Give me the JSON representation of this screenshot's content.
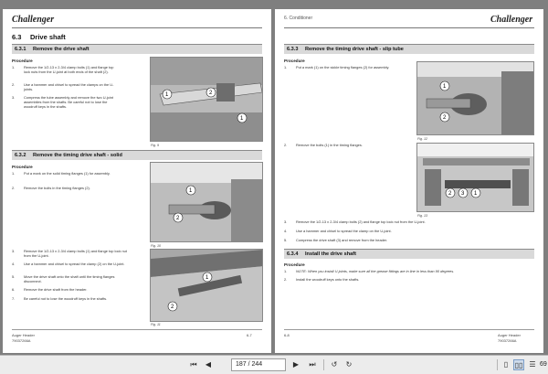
{
  "left_page": {
    "brand": "Challenger",
    "section_title": "6.3",
    "section_name": "Drive shaft",
    "sub1": {
      "number": "6.3.1",
      "title": "Remove the drive shaft"
    },
    "proc1": "Procedure",
    "steps1": [
      {
        "n": "1.",
        "text": "Remove the 1/2-13 x 2-3/4 clamp bolts (1) and flange top lock nuts from the U-joint at both ends of the shaft (2)."
      },
      {
        "n": "2.",
        "text": "Use a hammer and chisel to spread the clamps on the U-joints."
      },
      {
        "n": "3.",
        "text": "Compress the tube assembly and remove the two U-joint assemblies from the shafts. Be careful not to lose the woodruff keys in the shafts."
      }
    ],
    "fig9": "Fig. 9",
    "sub2": {
      "number": "6.3.2",
      "title": "Remove the timing drive shaft - solid"
    },
    "proc2": "Procedure",
    "steps2a": [
      {
        "n": "1.",
        "text": "Put a mark on the solid timing flanges (1) for assembly."
      },
      {
        "n": "2.",
        "text": "Remove the bolts in the timing flanges (2)."
      }
    ],
    "fig10": "Fig. 10",
    "steps2b": [
      {
        "n": "3.",
        "text": "Remove the 1/2-13 x 2-3/4 clamp bolts (1) and flange top lock nut from the U-joint."
      },
      {
        "n": "4.",
        "text": "Use a hammer and chisel to spread the clamp (2) on the U-joint."
      },
      {
        "n": "5.",
        "text": "Move the drive shaft onto the shaft until the timing flanges disconnect."
      },
      {
        "n": "6.",
        "text": "Remove the drive shaft from the header."
      },
      {
        "n": "7.",
        "text": "Be careful not to lose the woodruff keys in the shafts."
      }
    ],
    "fig11": "Fig. 11",
    "footer_left_1": "Auger Header",
    "footer_left_2": "79037266A",
    "footer_right": "6-7"
  },
  "right_page": {
    "brand": "Challenger",
    "section_header": "6. Conditioner",
    "sub3": {
      "number": "6.3.3",
      "title": "Remove the timing drive shaft - slip tube"
    },
    "proc3": "Procedure",
    "steps3a": [
      {
        "n": "1.",
        "text": "Put a mark (1) on the sickle timing flanges (2) for assembly."
      }
    ],
    "fig12": "Fig. 12",
    "steps3b": [
      {
        "n": "2.",
        "text": "Remove the bolts (1) in the timing flanges."
      }
    ],
    "fig13": "Fig. 13",
    "steps3c": [
      {
        "n": "3.",
        "text": "Remove the 1/2-13 x 2-3/4 clamp bolts (2) and flange top lock nut from the U-joint."
      },
      {
        "n": "4.",
        "text": "Use a hammer and chisel to spread the clamp on the U-joint."
      },
      {
        "n": "5.",
        "text": "Compress the drive shaft (3) and remove from the header."
      }
    ],
    "sub4": {
      "number": "6.3.4",
      "title": "Install the drive shaft"
    },
    "proc4": "Procedure",
    "steps4": [
      {
        "n": "1.",
        "text": "NOTE: When you install U-joints, make sure all the grease fittings are in line in less than 90 degrees."
      },
      {
        "n": "2.",
        "text": "Install the woodruff keys onto the shafts."
      }
    ],
    "footer_left": "6-8",
    "footer_right_1": "Auger Header",
    "footer_right_2": "79037266A"
  },
  "toolbar": {
    "page_indicator": "187 / 244",
    "zoom": "69"
  }
}
